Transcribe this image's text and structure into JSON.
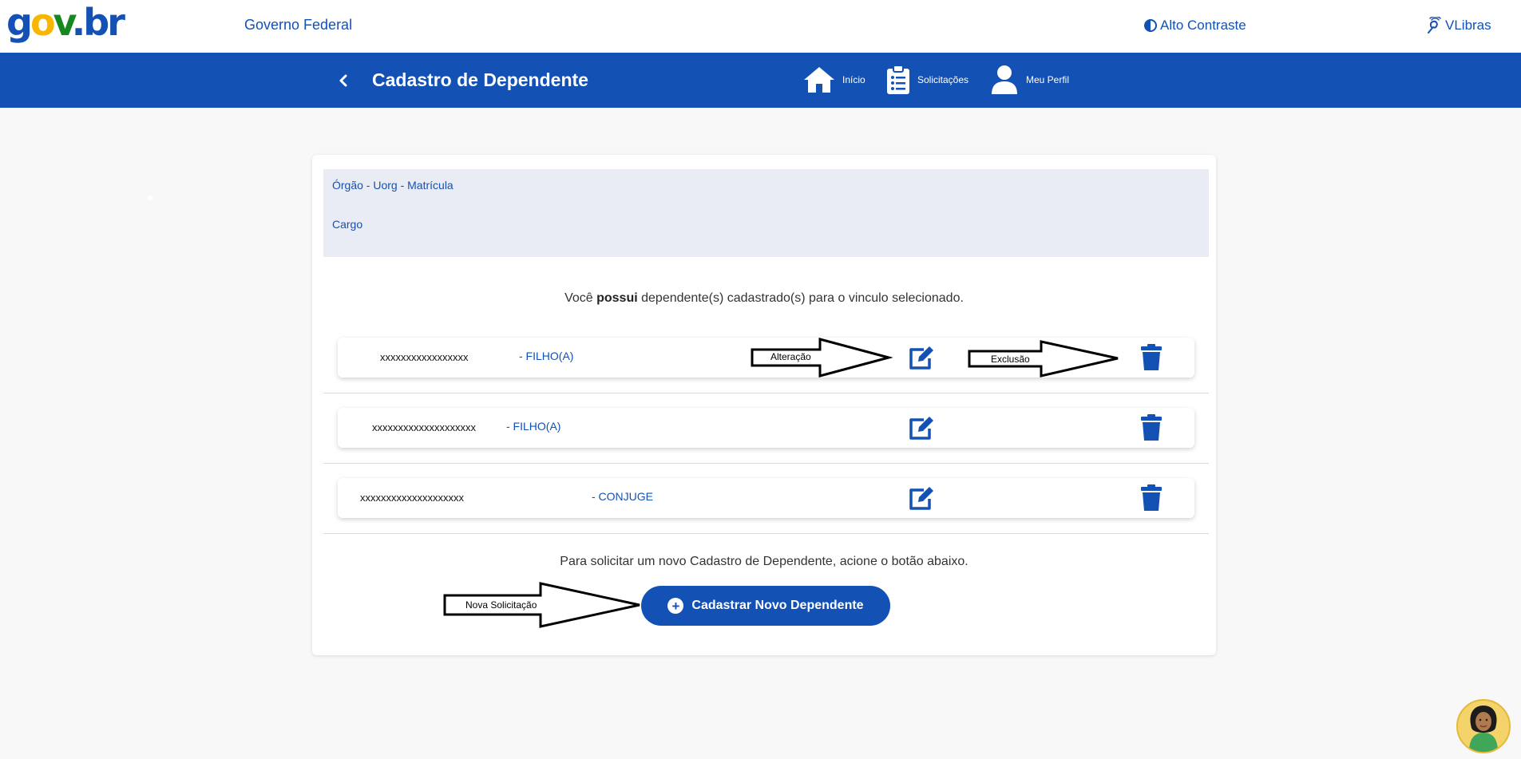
{
  "header": {
    "logo_letters": [
      "g",
      "o",
      "v",
      ".",
      "br"
    ],
    "site_name": "Governo Federal",
    "contrast_label": "Alto Contraste",
    "vlibras_label": "VLibras"
  },
  "navbar": {
    "back_icon": "chevron-left-icon",
    "title": "Cadastro de Dependente",
    "items": [
      {
        "label": "Início",
        "icon": "home-icon"
      },
      {
        "label": "Solicitações",
        "icon": "clipboard-list-icon"
      },
      {
        "label": "Meu Perfil",
        "icon": "user-icon"
      }
    ]
  },
  "card": {
    "info": {
      "line1": "Órgão - Uorg - Matrícula",
      "line2": "Cargo"
    },
    "message_prefix": "Você ",
    "message_bold": "possui",
    "message_suffix": " dependente(s) cadastrado(s) para o vinculo selecionado.",
    "dependents": [
      {
        "name": "xxxxxxxxxxxxxxxxx",
        "relation": "- FILHO(A)"
      },
      {
        "name": "xxxxxxxxxxxxxxxxxxxx",
        "relation": "- FILHO(A)"
      },
      {
        "name": "xxxxxxxxxxxxxxxxxxxx",
        "relation": "- CONJUGE"
      }
    ],
    "new_request_message": "Para solicitar um novo Cadastro de Dependente, acione o botão abaixo.",
    "new_button_label": "Cadastrar Novo Dependente"
  },
  "annotations": {
    "edit_arrow": "Alteração",
    "delete_arrow": "Exclusão",
    "new_arrow": "Nova Solicitação"
  },
  "colors": {
    "primary": "#1351b4",
    "background": "#f8f8f8",
    "info_box": "#e9ecf4"
  }
}
